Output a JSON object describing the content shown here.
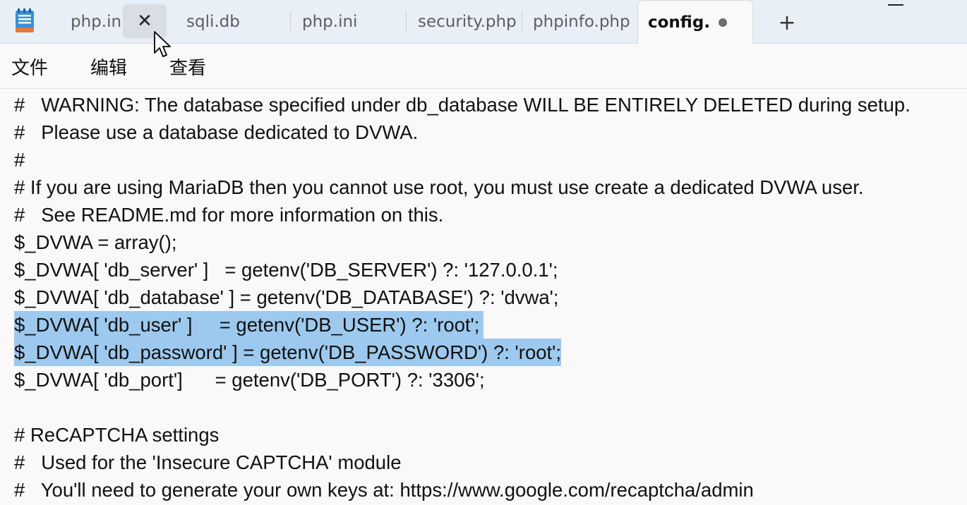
{
  "tabs": [
    {
      "label": "php.in"
    },
    {
      "label": "sqli.db"
    },
    {
      "label": "php.ini"
    },
    {
      "label": "security.php"
    },
    {
      "label": "phpinfo.php"
    },
    {
      "label": "config."
    }
  ],
  "tab_close_glyph": "✕",
  "new_tab_glyph": "+",
  "menu": [
    "文件",
    "编辑",
    "查看"
  ],
  "editor": {
    "lines": [
      "#   WARNING: The database specified under db_database WILL BE ENTIRELY DELETED during setup.",
      "#   Please use a database dedicated to DVWA.",
      "#",
      "# If you are using MariaDB then you cannot use root, you must use create a dedicated DVWA user.",
      "#   See README.md for more information on this.",
      "$_DVWA = array();",
      "$_DVWA[ 'db_server' ]   = getenv('DB_SERVER') ?: '127.0.0.1';",
      "$_DVWA[ 'db_database' ] = getenv('DB_DATABASE') ?: 'dvwa';",
      "$_DVWA[ 'db_user' ]     = getenv('DB_USER') ?: 'root';",
      "$_DVWA[ 'db_password' ] = getenv('DB_PASSWORD') ?: 'root';",
      "$_DVWA[ 'db_port']      = getenv('DB_PORT') ?: '3306';",
      "",
      "# ReCAPTCHA settings",
      "#   Used for the 'Insecure CAPTCHA' module",
      "#   You'll need to generate your own keys at: https://www.google.com/recaptcha/admin"
    ],
    "selected_lines": [
      8,
      9
    ]
  },
  "colors": {
    "selection": "#9dc9ee",
    "tabbar": "#e9eff6"
  }
}
